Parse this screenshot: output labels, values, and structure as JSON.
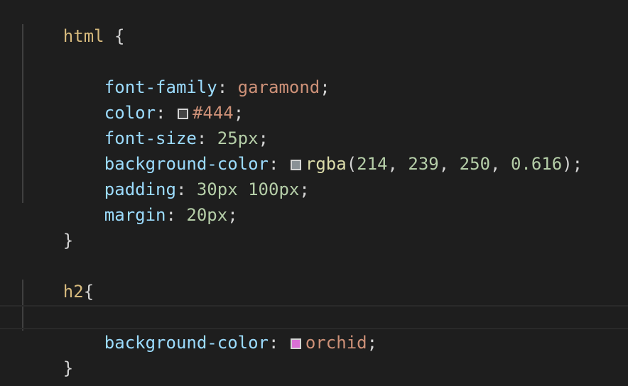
{
  "rule1": {
    "selector": "html",
    "open_brace": "{",
    "close_brace": "}",
    "decls": {
      "font_family": {
        "prop": "font-family",
        "colon": ": ",
        "value": "garamond",
        "semi": ";"
      },
      "color": {
        "prop": "color",
        "colon": ": ",
        "value": "#444",
        "swatch": "#444444",
        "semi": ";"
      },
      "font_size": {
        "prop": "font-size",
        "colon": ": ",
        "value": "25px",
        "semi": ";"
      },
      "background_color": {
        "prop": "background-color",
        "colon": ": ",
        "fn": "rgba",
        "open": "(",
        "a1": "214",
        "c1": ", ",
        "a2": "239",
        "c2": ", ",
        "a3": "250",
        "c3": ", ",
        "a4": "0.616",
        "close": ")",
        "swatch": "#8a9196",
        "semi": ";"
      },
      "padding": {
        "prop": "padding",
        "colon": ": ",
        "value1": "30px",
        "space": " ",
        "value2": "100px",
        "semi": ";"
      },
      "margin": {
        "prop": "margin",
        "colon": ": ",
        "value": "20px",
        "semi": ";"
      }
    }
  },
  "rule2": {
    "selector": "h2",
    "open_brace": "{",
    "close_brace": "}",
    "decls": {
      "background_color": {
        "prop": "background-color",
        "colon": ": ",
        "value": "orchid",
        "swatch": "#da70d6",
        "semi": ";"
      }
    }
  }
}
